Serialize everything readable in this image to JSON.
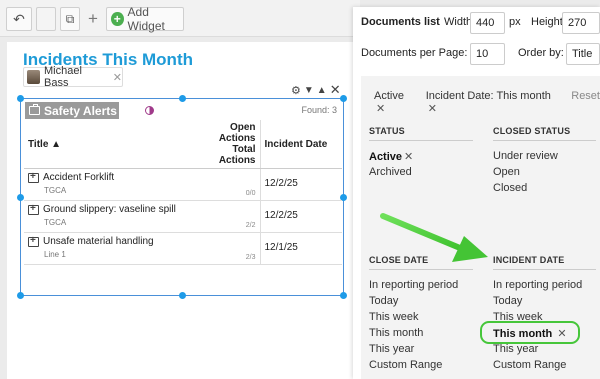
{
  "toolbar": {
    "add_widget_label": "Add Widget"
  },
  "dashboard": {
    "title": "Incidents This Month",
    "user_chip": "Michael Bass"
  },
  "widget": {
    "name": "Safety Alerts",
    "found": "Found: 3",
    "columns": {
      "title": "Title ▲",
      "actions_line1": "Open Actions",
      "actions_line2": "Total Actions",
      "date": "Incident Date"
    },
    "rows": [
      {
        "title": "Accident Forklift",
        "sub": "TGCA",
        "actions": "0/0",
        "date": "12/2/25"
      },
      {
        "title": "Ground slippery: vaseline spill",
        "sub": "TGCA",
        "actions": "2/2",
        "date": "12/2/25"
      },
      {
        "title": "Unsafe material handling",
        "sub": "Line 1",
        "actions": "2/3",
        "date": "12/1/25"
      }
    ]
  },
  "panel": {
    "type_label": "Documents list",
    "width_label": "Width:",
    "width_value": "440",
    "width_unit": "px",
    "height_label": "Height:",
    "height_value": "270",
    "per_page_label": "Documents per Page:",
    "per_page_value": "10",
    "order_label": "Order by:",
    "order_value": "Title",
    "active_filters": [
      "Active",
      "Incident Date: This month"
    ],
    "reset_label": "Reset",
    "sections": {
      "status": {
        "title": "STATUS",
        "options": [
          "Active",
          "Archived"
        ]
      },
      "closed_status": {
        "title": "CLOSED STATUS",
        "options": [
          "Under review",
          "Open",
          "Closed"
        ]
      },
      "close_date": {
        "title": "CLOSE DATE",
        "options": [
          "In reporting period",
          "Today",
          "This week",
          "This month",
          "This year",
          "Custom Range"
        ]
      },
      "incident_date": {
        "title": "INCIDENT DATE",
        "options": [
          "In reporting period",
          "Today",
          "This week",
          "This month",
          "This year",
          "Custom Range"
        ]
      }
    }
  },
  "colors": {
    "title_blue": "#1e9bd7",
    "selection_blue": "#1e9be8",
    "highlight_green": "#46c63a"
  }
}
